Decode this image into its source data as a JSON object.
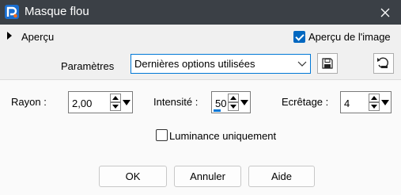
{
  "titlebar": {
    "title": "Masque flou",
    "close_icon": "close-icon"
  },
  "preview": {
    "label": "Aperçu",
    "image_preview_label": "Aperçu de l'image",
    "image_preview_checked": true
  },
  "settings": {
    "label": "Paramètres",
    "selected_preset": "Dernières options utilisées",
    "save_icon": "floppy-disk-icon",
    "reset_icon": "reset-arrow-icon"
  },
  "fields": {
    "radius": {
      "label": "Rayon :",
      "value": "2,00"
    },
    "intensity": {
      "label": "Intensité :",
      "value": "50",
      "level": 0.5
    },
    "clipping": {
      "label": "Ecrêtage :",
      "value": "4"
    }
  },
  "luminance": {
    "label": "Luminance uniquement",
    "checked": false
  },
  "buttons": {
    "ok": "OK",
    "cancel": "Annuler",
    "help": "Aide"
  },
  "colors": {
    "titlebar": "#3b4046",
    "accent": "#0078d7",
    "checkbox": "#0067c0"
  }
}
